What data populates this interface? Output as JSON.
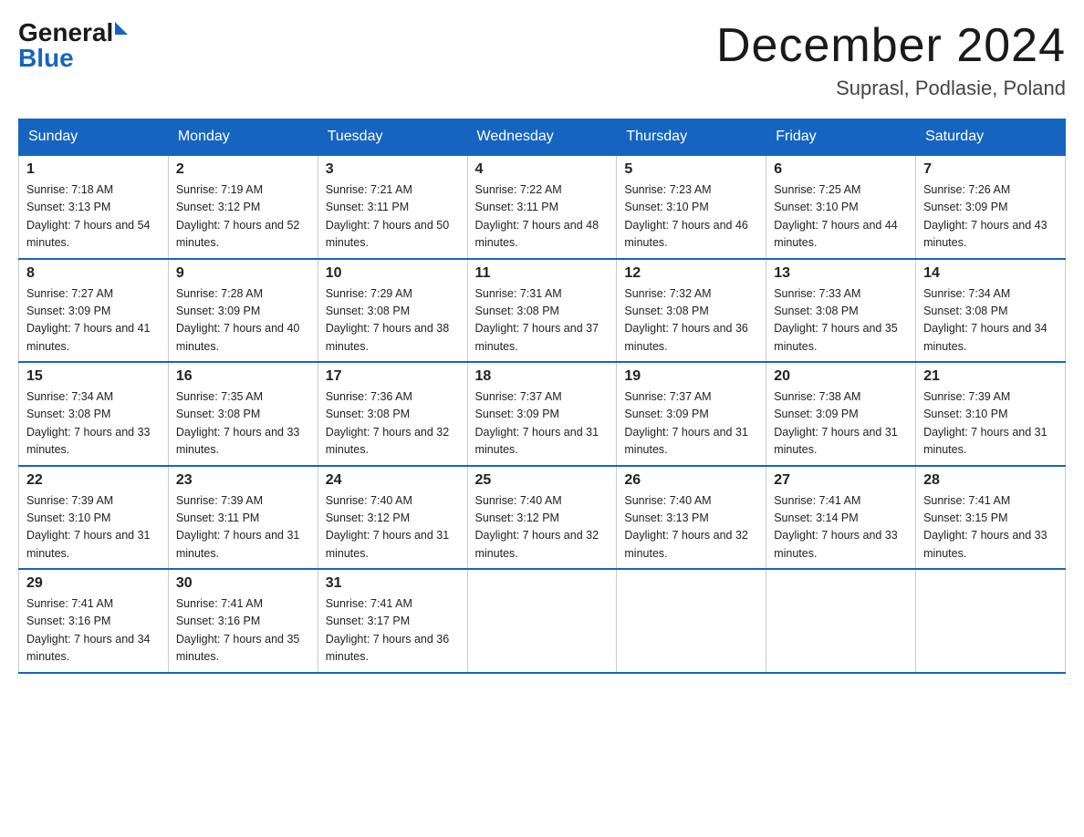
{
  "header": {
    "logo_general": "General",
    "logo_blue": "Blue",
    "month_title": "December 2024",
    "subtitle": "Suprasl, Podlasie, Poland"
  },
  "days_of_week": [
    "Sunday",
    "Monday",
    "Tuesday",
    "Wednesday",
    "Thursday",
    "Friday",
    "Saturday"
  ],
  "weeks": [
    [
      {
        "day": "1",
        "sunrise": "7:18 AM",
        "sunset": "3:13 PM",
        "daylight": "7 hours and 54 minutes."
      },
      {
        "day": "2",
        "sunrise": "7:19 AM",
        "sunset": "3:12 PM",
        "daylight": "7 hours and 52 minutes."
      },
      {
        "day": "3",
        "sunrise": "7:21 AM",
        "sunset": "3:11 PM",
        "daylight": "7 hours and 50 minutes."
      },
      {
        "day": "4",
        "sunrise": "7:22 AM",
        "sunset": "3:11 PM",
        "daylight": "7 hours and 48 minutes."
      },
      {
        "day": "5",
        "sunrise": "7:23 AM",
        "sunset": "3:10 PM",
        "daylight": "7 hours and 46 minutes."
      },
      {
        "day": "6",
        "sunrise": "7:25 AM",
        "sunset": "3:10 PM",
        "daylight": "7 hours and 44 minutes."
      },
      {
        "day": "7",
        "sunrise": "7:26 AM",
        "sunset": "3:09 PM",
        "daylight": "7 hours and 43 minutes."
      }
    ],
    [
      {
        "day": "8",
        "sunrise": "7:27 AM",
        "sunset": "3:09 PM",
        "daylight": "7 hours and 41 minutes."
      },
      {
        "day": "9",
        "sunrise": "7:28 AM",
        "sunset": "3:09 PM",
        "daylight": "7 hours and 40 minutes."
      },
      {
        "day": "10",
        "sunrise": "7:29 AM",
        "sunset": "3:08 PM",
        "daylight": "7 hours and 38 minutes."
      },
      {
        "day": "11",
        "sunrise": "7:31 AM",
        "sunset": "3:08 PM",
        "daylight": "7 hours and 37 minutes."
      },
      {
        "day": "12",
        "sunrise": "7:32 AM",
        "sunset": "3:08 PM",
        "daylight": "7 hours and 36 minutes."
      },
      {
        "day": "13",
        "sunrise": "7:33 AM",
        "sunset": "3:08 PM",
        "daylight": "7 hours and 35 minutes."
      },
      {
        "day": "14",
        "sunrise": "7:34 AM",
        "sunset": "3:08 PM",
        "daylight": "7 hours and 34 minutes."
      }
    ],
    [
      {
        "day": "15",
        "sunrise": "7:34 AM",
        "sunset": "3:08 PM",
        "daylight": "7 hours and 33 minutes."
      },
      {
        "day": "16",
        "sunrise": "7:35 AM",
        "sunset": "3:08 PM",
        "daylight": "7 hours and 33 minutes."
      },
      {
        "day": "17",
        "sunrise": "7:36 AM",
        "sunset": "3:08 PM",
        "daylight": "7 hours and 32 minutes."
      },
      {
        "day": "18",
        "sunrise": "7:37 AM",
        "sunset": "3:09 PM",
        "daylight": "7 hours and 31 minutes."
      },
      {
        "day": "19",
        "sunrise": "7:37 AM",
        "sunset": "3:09 PM",
        "daylight": "7 hours and 31 minutes."
      },
      {
        "day": "20",
        "sunrise": "7:38 AM",
        "sunset": "3:09 PM",
        "daylight": "7 hours and 31 minutes."
      },
      {
        "day": "21",
        "sunrise": "7:39 AM",
        "sunset": "3:10 PM",
        "daylight": "7 hours and 31 minutes."
      }
    ],
    [
      {
        "day": "22",
        "sunrise": "7:39 AM",
        "sunset": "3:10 PM",
        "daylight": "7 hours and 31 minutes."
      },
      {
        "day": "23",
        "sunrise": "7:39 AM",
        "sunset": "3:11 PM",
        "daylight": "7 hours and 31 minutes."
      },
      {
        "day": "24",
        "sunrise": "7:40 AM",
        "sunset": "3:12 PM",
        "daylight": "7 hours and 31 minutes."
      },
      {
        "day": "25",
        "sunrise": "7:40 AM",
        "sunset": "3:12 PM",
        "daylight": "7 hours and 32 minutes."
      },
      {
        "day": "26",
        "sunrise": "7:40 AM",
        "sunset": "3:13 PM",
        "daylight": "7 hours and 32 minutes."
      },
      {
        "day": "27",
        "sunrise": "7:41 AM",
        "sunset": "3:14 PM",
        "daylight": "7 hours and 33 minutes."
      },
      {
        "day": "28",
        "sunrise": "7:41 AM",
        "sunset": "3:15 PM",
        "daylight": "7 hours and 33 minutes."
      }
    ],
    [
      {
        "day": "29",
        "sunrise": "7:41 AM",
        "sunset": "3:16 PM",
        "daylight": "7 hours and 34 minutes."
      },
      {
        "day": "30",
        "sunrise": "7:41 AM",
        "sunset": "3:16 PM",
        "daylight": "7 hours and 35 minutes."
      },
      {
        "day": "31",
        "sunrise": "7:41 AM",
        "sunset": "3:17 PM",
        "daylight": "7 hours and 36 minutes."
      },
      null,
      null,
      null,
      null
    ]
  ]
}
